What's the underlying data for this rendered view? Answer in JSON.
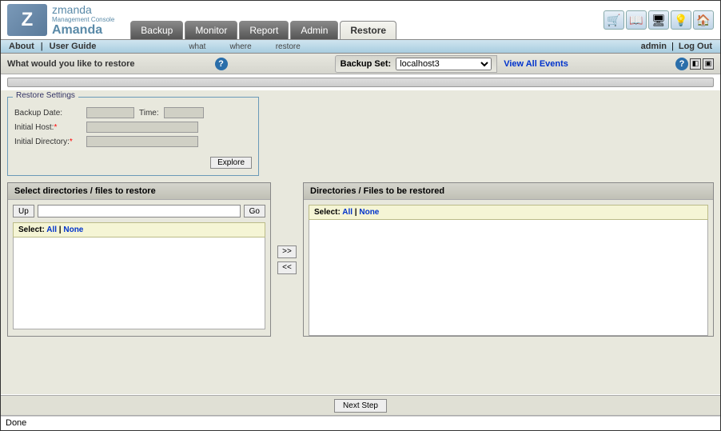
{
  "header": {
    "brand": "zmanda",
    "subbrand": "Management Console",
    "brandbig": "Amanda",
    "tabs": [
      "Backup",
      "Monitor",
      "Report",
      "Admin",
      "Restore"
    ],
    "active_tab": "Restore"
  },
  "subbar": {
    "about": "About",
    "user_guide": "User Guide",
    "sublinks": [
      "what",
      "where",
      "restore"
    ],
    "admin": "admin",
    "logout": "Log Out"
  },
  "titlebar": {
    "title": "What would you like to restore",
    "backup_set_label": "Backup Set:",
    "backup_set_value": "localhost3",
    "view_events": "View All Events"
  },
  "restore_settings": {
    "legend": "Restore Settings",
    "backup_date_label": "Backup Date:",
    "backup_date_value": "",
    "time_label": "Time:",
    "time_value": "",
    "initial_host_label": "Initial Host:",
    "initial_host_value": "",
    "initial_dir_label": "Initial Directory:",
    "initial_dir_value": "",
    "explore": "Explore"
  },
  "left_panel": {
    "title": "Select directories / files to restore",
    "up": "Up",
    "go": "Go",
    "path": "",
    "select_label": "Select:",
    "all": "All",
    "none": "None"
  },
  "right_panel": {
    "title": "Directories / Files to be restored",
    "select_label": "Select:",
    "all": "All",
    "none": "None"
  },
  "mid": {
    "fwd": ">>",
    "back": "<<"
  },
  "footer": {
    "next": "Next Step"
  },
  "status": "Done"
}
